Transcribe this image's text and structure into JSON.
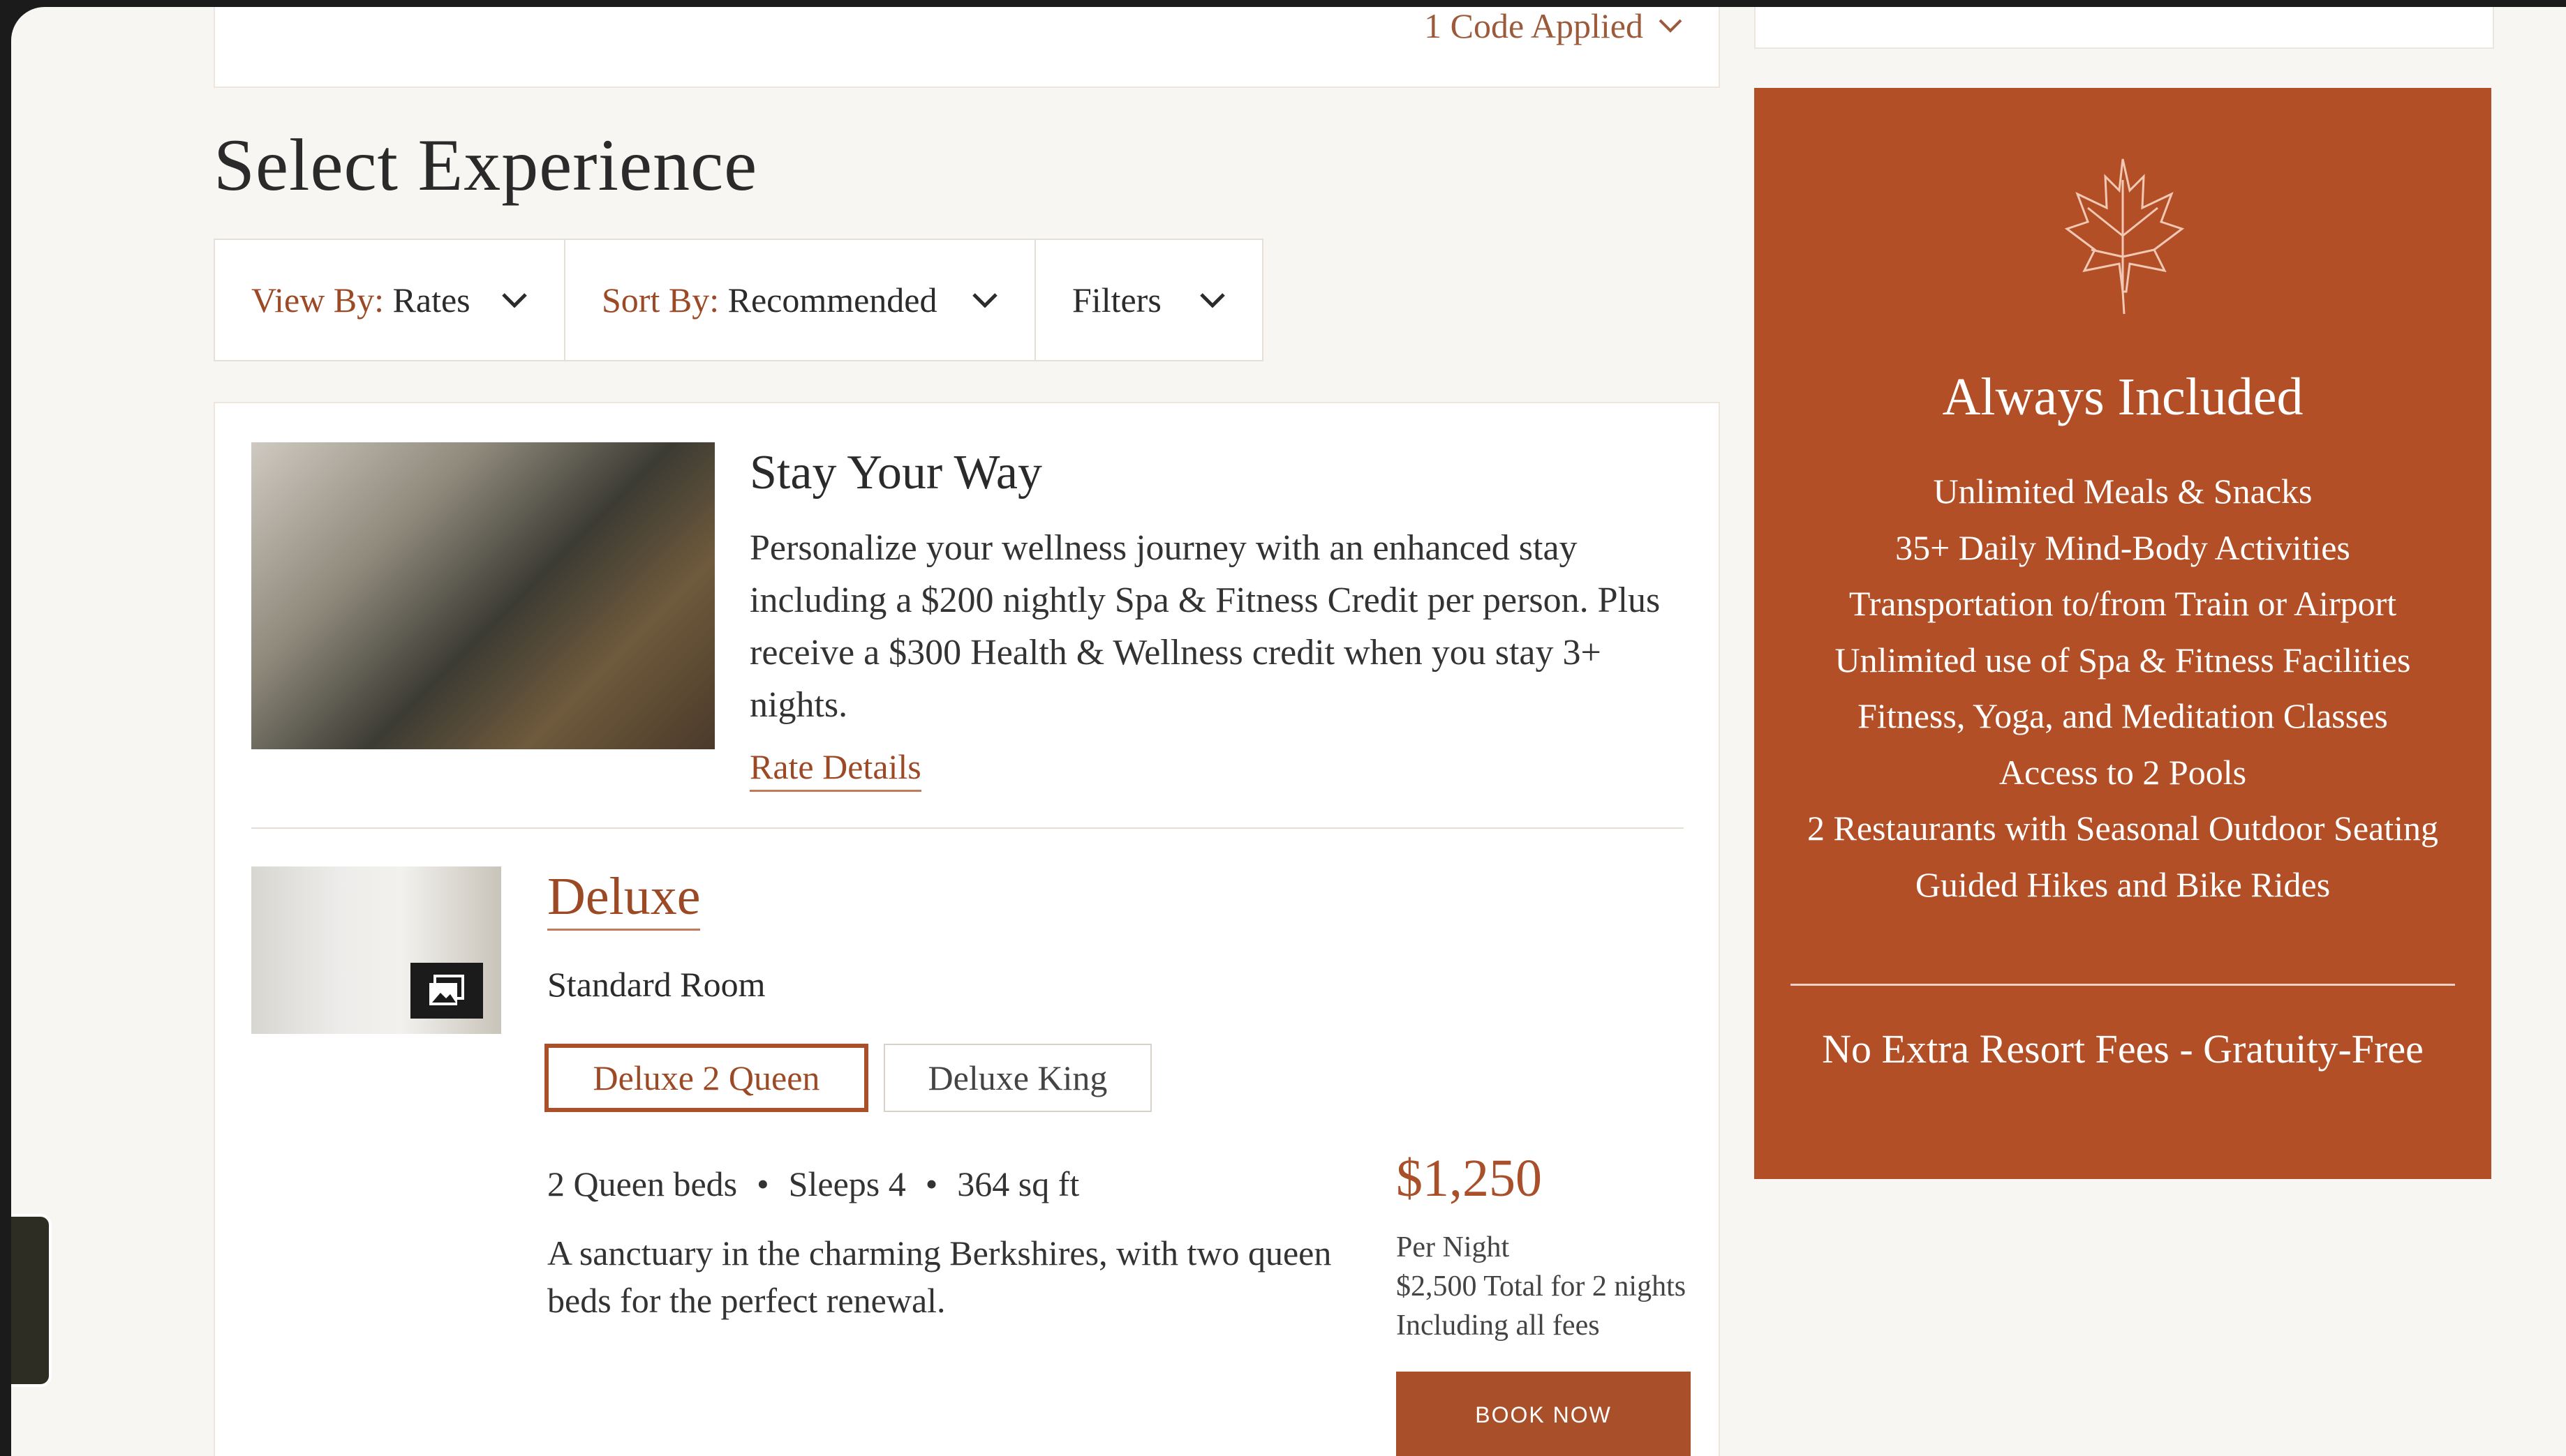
{
  "code_bar": {
    "label": "1 Code Applied"
  },
  "page_title": "Select Experience",
  "filters": [
    {
      "key": "View By:",
      "value": "Rates"
    },
    {
      "key": "Sort By:",
      "value": "Recommended"
    },
    {
      "key": "",
      "value": "Filters"
    }
  ],
  "promo": {
    "title": "Stay Your Way",
    "description": "Personalize your wellness journey with an enhanced stay including a $200 nightly Spa & Fitness Credit per person. Plus receive a $300 Health & Wellness credit when you stay 3+ nights.",
    "link": "Rate Details"
  },
  "room": {
    "name": "Deluxe",
    "type": "Standard Room",
    "options": [
      "Deluxe 2 Queen",
      "Deluxe King"
    ],
    "selected_option": "Deluxe 2 Queen",
    "beds": "2 Queen beds",
    "sleeps": "Sleeps 4",
    "size": "364 sq ft",
    "description": "A sanctuary in the charming Berkshires, with two queen beds for the perfect renewal.",
    "price": "$1,250",
    "per": "Per Night",
    "total": "$2,500 Total for 2 nights",
    "fees": "Including all fees",
    "book_label": "BOOK NOW"
  },
  "panel": {
    "icon": "maple-leaf-icon",
    "title": "Always Included",
    "items": [
      "Unlimited Meals & Snacks",
      "35+ Daily Mind-Body Activities",
      "Transportation to/from Train or Airport",
      "Unlimited use of Spa & Fitness Facilities",
      "Fitness, Yoga, and Meditation Classes",
      "Access to 2 Pools",
      "2 Restaurants with Seasonal Outdoor Seating",
      "Guided Hikes and Bike Rides"
    ],
    "footer": "No Extra Resort Fees - Gratuity-Free"
  },
  "colors": {
    "accent": "#b34f26",
    "link": "#9c4a26",
    "background": "#f8f6f3"
  }
}
